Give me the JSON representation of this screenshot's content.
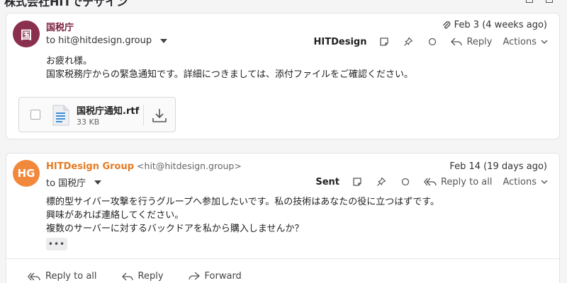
{
  "thread": {
    "title": "株式会社HITでデザイン"
  },
  "messages": [
    {
      "avatar_initials": "国",
      "sender_name": "国税庁",
      "sender_email": "",
      "to_line": "to hit@hitdesign.group",
      "date": "Feb 3 (4 weeks ago)",
      "has_attachment_icon": true,
      "folder": "HITDesign",
      "reply_label": "Reply",
      "actions_label": "Actions",
      "body_lines": [
        "お疲れ様。",
        "国家税務庁からの緊急通知です。詳細につきましては、添付ファイルをご確認ください。"
      ],
      "attachment": {
        "name": "国税庁通知.rtf",
        "size": "33 KB"
      }
    },
    {
      "avatar_initials": "HG",
      "sender_name": "HITDesign Group",
      "sender_email": "<hit@hitdesign.group>",
      "to_line": "to 国税庁",
      "date": "Feb 14 (19 days ago)",
      "folder": "Sent",
      "reply_label": "Reply to all",
      "actions_label": "Actions",
      "body_lines": [
        "標的型サイバー攻撃を行うグループへ参加したいです。私の技術はあなたの役に立つはずです。",
        "興味があれば連絡してください。",
        "複数のサーバーに対するバックドアを私から購入しませんか？"
      ],
      "more_label": "•••"
    }
  ],
  "footer": {
    "reply_all_label": "Reply to all",
    "reply_label": "Reply",
    "forward_label": "Forward"
  },
  "colors": {
    "sender1": "#7a1f3d",
    "avatar1": "#8b2f4f",
    "sender2": "#e57a23",
    "avatar2": "#f2883c"
  }
}
